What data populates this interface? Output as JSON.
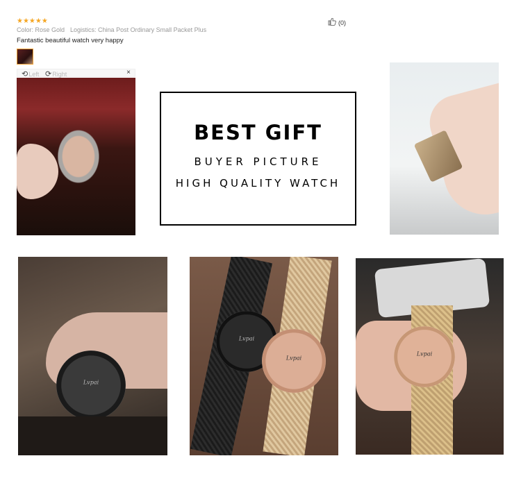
{
  "review": {
    "stars": "★★★★★",
    "color_label": "Color: Rose Gold",
    "logistics_label": "Logistics: China Post Ordinary Small Packet Plus",
    "text": "Fantastic beautiful watch very happy",
    "likes": "(0)"
  },
  "viewer": {
    "rotate_left": "Left",
    "rotate_right": "Right",
    "close": "×"
  },
  "banner": {
    "title": "BEST GIFT",
    "line1": "BUYER PICTURE",
    "line2": "HIGH QUALITY WATCH"
  },
  "watch_logo": "Lvpai",
  "colors": {
    "star": "#f5a623",
    "thumb_border": "#f0a030"
  }
}
